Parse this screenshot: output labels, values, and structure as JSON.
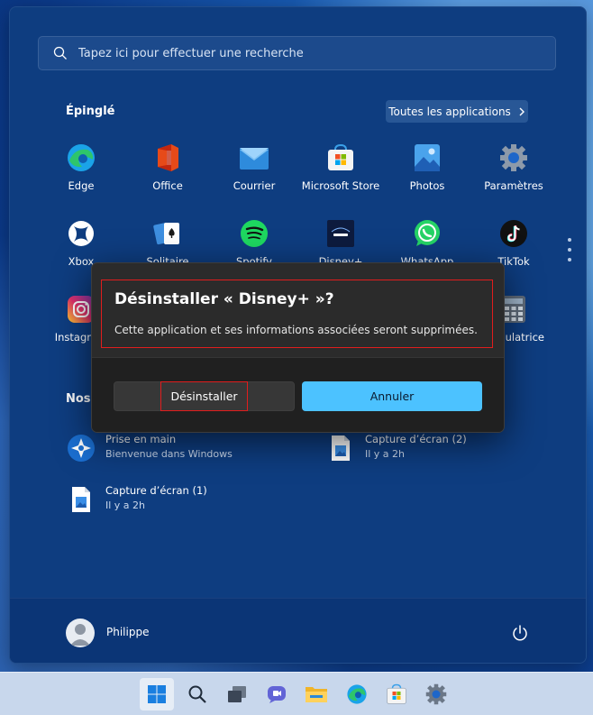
{
  "search": {
    "placeholder": "Tapez ici pour effectuer une recherche"
  },
  "pinned": {
    "title": "Épinglé",
    "all_apps_label": "Toutes les applications",
    "apps_row1": [
      {
        "label": "Edge",
        "icon": "edge-icon"
      },
      {
        "label": "Office",
        "icon": "office-icon"
      },
      {
        "label": "Courrier",
        "icon": "mail-icon"
      },
      {
        "label": "Microsoft Store",
        "icon": "store-icon"
      },
      {
        "label": "Photos",
        "icon": "photos-icon"
      },
      {
        "label": "Paramètres",
        "icon": "settings-icon"
      }
    ],
    "apps_row2": [
      {
        "label": "Xbox",
        "icon": "xbox-icon"
      },
      {
        "label": "Solitaire",
        "icon": "solitaire-icon"
      },
      {
        "label": "Spotify",
        "icon": "spotify-icon"
      },
      {
        "label": "Disney+",
        "icon": "disney-icon"
      },
      {
        "label": "WhatsApp",
        "icon": "whatsapp-icon"
      },
      {
        "label": "TikTok",
        "icon": "tiktok-icon"
      }
    ],
    "apps_row3": [
      {
        "label": "Instagram",
        "icon": "instagram-icon"
      },
      {
        "label": "Calculatrice",
        "icon": "calculator-icon"
      }
    ]
  },
  "recommended": {
    "title": "Nos",
    "items": [
      {
        "title": "Prise en main",
        "subtitle": "Bienvenue dans Windows",
        "icon": "get-started-icon"
      },
      {
        "title": "Capture d’écran (2)",
        "subtitle": "Il y a 2h",
        "icon": "image-file-icon"
      },
      {
        "title": "Capture d’écran (1)",
        "subtitle": "Il y a 2h",
        "icon": "image-file-icon"
      }
    ]
  },
  "user": {
    "name": "Philippe"
  },
  "dialog": {
    "title": "Désinstaller « Disney+ »?",
    "body": "Cette application et ses informations associées seront supprimées.",
    "uninstall_label": "Désinstaller",
    "cancel_label": "Annuler"
  },
  "colors": {
    "accent": "#4cc2ff",
    "highlight": "#e11d1d",
    "menu_bg": "#0e3d80"
  },
  "taskbar": [
    "start-icon",
    "search-icon",
    "task-view-icon",
    "chat-icon",
    "file-explorer-icon",
    "edge-icon",
    "store-icon",
    "settings-icon"
  ]
}
